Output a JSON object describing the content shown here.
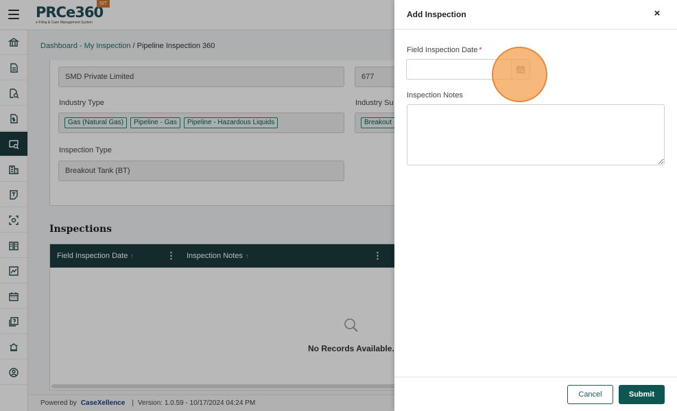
{
  "app": {
    "logo_text": "PRCe360",
    "logo_subtitle": "e-Filing & Case Management System",
    "env_badge": "SIT"
  },
  "breadcrumb": {
    "link": "Dashboard - My Inspection",
    "separator": " / ",
    "current": "Pipeline Inspection 360"
  },
  "details": {
    "company_name": "SMD Private Limited",
    "company_id": "677",
    "industry_type_label": "Industry Type",
    "industry_types": [
      "Gas (Natural Gas)",
      "Pipeline - Gas",
      "Pipeline - Hazardous Liquids"
    ],
    "industry_subtype_label": "Industry Su",
    "industry_subtype_chip": "Breakout",
    "inspection_type_label": "Inspection Type",
    "inspection_type": "Breakout Tank (BT)"
  },
  "inspections": {
    "title": "Inspections",
    "columns": [
      "Field Inspection Date",
      "Inspection Notes"
    ],
    "empty_text": "No Records Available."
  },
  "footer": {
    "powered_by": "Powered by",
    "brand": "CaseXellence",
    "separator": "|",
    "version": "Version: 1.0.59 - 10/17/2024 04:24 PM"
  },
  "drawer": {
    "title": "Add Inspection",
    "close_symbol": "×",
    "date_label": "Field Inspection Date",
    "required_mark": "*",
    "date_value": "",
    "notes_label": "Inspection Notes",
    "notes_value": "",
    "cancel_label": "Cancel",
    "submit_label": "Submit"
  },
  "colors": {
    "sidebar_active": "#1d3c40",
    "primary": "#0f5551",
    "accent_badge": "#d4742a",
    "click_marker": "#f4a050"
  },
  "sidebar_icons": [
    "bank-icon",
    "document-icon",
    "document-search-icon",
    "file-dollar-icon",
    "inspection-icon",
    "building-icon",
    "note-icon",
    "scan-icon",
    "book-icon",
    "chart-icon",
    "calendar-icon",
    "help-icon",
    "alarm-icon",
    "user-circle-icon"
  ]
}
